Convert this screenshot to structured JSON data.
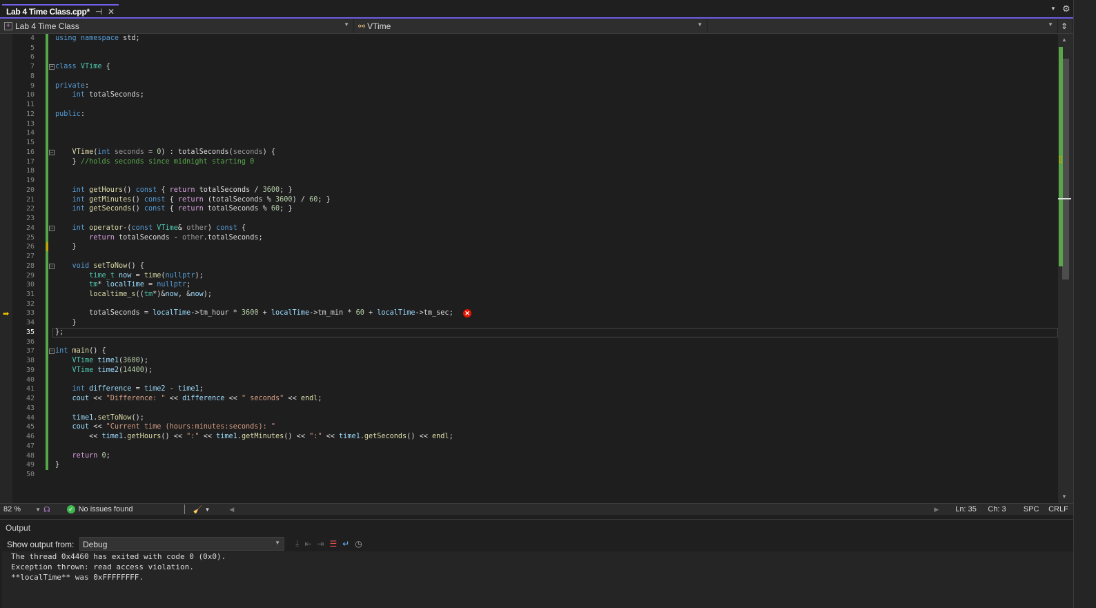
{
  "tab": {
    "title": "Lab 4 Time Class.cpp*",
    "pin_icon": "pin-icon",
    "close_icon": "close-icon"
  },
  "nav": {
    "project": "Lab 4 Time Class",
    "scope": "VTime",
    "member": ""
  },
  "code": {
    "current_line": 35,
    "error_line": 33,
    "lines": [
      {
        "n": 4,
        "t": [
          [
            "kw",
            "using"
          ],
          [
            "pl",
            " "
          ],
          [
            "kw",
            "namespace"
          ],
          [
            "pl",
            " std;"
          ]
        ]
      },
      {
        "n": 5,
        "t": []
      },
      {
        "n": 6,
        "t": []
      },
      {
        "n": 7,
        "t": [
          [
            "kw",
            "class"
          ],
          [
            "pl",
            " "
          ],
          [
            "type",
            "VTime"
          ],
          [
            "pl",
            " {"
          ]
        ],
        "fold": true
      },
      {
        "n": 8,
        "t": []
      },
      {
        "n": 9,
        "t": [
          [
            "kw",
            "private"
          ],
          [
            "pl",
            ":"
          ]
        ]
      },
      {
        "n": 10,
        "t": [
          [
            "pl",
            "    "
          ],
          [
            "kw",
            "int"
          ],
          [
            "pl",
            " "
          ],
          [
            "mem",
            "totalSeconds"
          ],
          [
            "pl",
            ";"
          ]
        ]
      },
      {
        "n": 11,
        "t": []
      },
      {
        "n": 12,
        "t": [
          [
            "kw",
            "public"
          ],
          [
            "pl",
            ":"
          ]
        ]
      },
      {
        "n": 13,
        "t": []
      },
      {
        "n": 14,
        "t": []
      },
      {
        "n": 15,
        "t": []
      },
      {
        "n": 16,
        "t": [
          [
            "pl",
            "    "
          ],
          [
            "fn",
            "VTime"
          ],
          [
            "pl",
            "("
          ],
          [
            "kw",
            "int"
          ],
          [
            "pl",
            " "
          ],
          [
            "par",
            "seconds"
          ],
          [
            "pl",
            " = "
          ],
          [
            "num",
            "0"
          ],
          [
            "pl",
            ") : "
          ],
          [
            "mem",
            "totalSeconds"
          ],
          [
            "pl",
            "("
          ],
          [
            "par",
            "seconds"
          ],
          [
            "pl",
            ") {"
          ]
        ],
        "fold": true
      },
      {
        "n": 17,
        "t": [
          [
            "pl",
            "    } "
          ],
          [
            "cm",
            "//holds seconds since midnight starting 0"
          ]
        ]
      },
      {
        "n": 18,
        "t": []
      },
      {
        "n": 19,
        "t": []
      },
      {
        "n": 20,
        "t": [
          [
            "pl",
            "    "
          ],
          [
            "kw",
            "int"
          ],
          [
            "pl",
            " "
          ],
          [
            "fn",
            "getHours"
          ],
          [
            "pl",
            "() "
          ],
          [
            "kw",
            "const"
          ],
          [
            "pl",
            " { "
          ],
          [
            "ctl",
            "return"
          ],
          [
            "pl",
            " "
          ],
          [
            "mem",
            "totalSeconds"
          ],
          [
            "pl",
            " / "
          ],
          [
            "num",
            "3600"
          ],
          [
            "pl",
            "; }"
          ]
        ]
      },
      {
        "n": 21,
        "t": [
          [
            "pl",
            "    "
          ],
          [
            "kw",
            "int"
          ],
          [
            "pl",
            " "
          ],
          [
            "fn",
            "getMinutes"
          ],
          [
            "pl",
            "() "
          ],
          [
            "kw",
            "const"
          ],
          [
            "pl",
            " { "
          ],
          [
            "ctl",
            "return"
          ],
          [
            "pl",
            " ("
          ],
          [
            "mem",
            "totalSeconds"
          ],
          [
            "pl",
            " % "
          ],
          [
            "num",
            "3600"
          ],
          [
            "pl",
            ") / "
          ],
          [
            "num",
            "60"
          ],
          [
            "pl",
            "; }"
          ]
        ]
      },
      {
        "n": 22,
        "t": [
          [
            "pl",
            "    "
          ],
          [
            "kw",
            "int"
          ],
          [
            "pl",
            " "
          ],
          [
            "fn",
            "getSeconds"
          ],
          [
            "pl",
            "() "
          ],
          [
            "kw",
            "const"
          ],
          [
            "pl",
            " { "
          ],
          [
            "ctl",
            "return"
          ],
          [
            "pl",
            " "
          ],
          [
            "mem",
            "totalSeconds"
          ],
          [
            "pl",
            " % "
          ],
          [
            "num",
            "60"
          ],
          [
            "pl",
            "; }"
          ]
        ]
      },
      {
        "n": 23,
        "t": []
      },
      {
        "n": 24,
        "t": [
          [
            "pl",
            "    "
          ],
          [
            "kw",
            "int"
          ],
          [
            "pl",
            " "
          ],
          [
            "fn",
            "operator-"
          ],
          [
            "pl",
            "("
          ],
          [
            "kw",
            "const"
          ],
          [
            "pl",
            " "
          ],
          [
            "type",
            "VTime"
          ],
          [
            "pl",
            "& "
          ],
          [
            "par",
            "other"
          ],
          [
            "pl",
            ") "
          ],
          [
            "kw",
            "const"
          ],
          [
            "pl",
            " {"
          ]
        ],
        "fold": true
      },
      {
        "n": 25,
        "t": [
          [
            "pl",
            "        "
          ],
          [
            "ctl",
            "return"
          ],
          [
            "pl",
            " "
          ],
          [
            "mem",
            "totalSeconds"
          ],
          [
            "pl",
            " - "
          ],
          [
            "par",
            "other"
          ],
          [
            "pl",
            "."
          ],
          [
            "mem",
            "totalSeconds"
          ],
          [
            "pl",
            ";"
          ]
        ]
      },
      {
        "n": 26,
        "t": [
          [
            "pl",
            "    }"
          ]
        ]
      },
      {
        "n": 27,
        "t": []
      },
      {
        "n": 28,
        "t": [
          [
            "pl",
            "    "
          ],
          [
            "kw",
            "void"
          ],
          [
            "pl",
            " "
          ],
          [
            "fn",
            "setToNow"
          ],
          [
            "pl",
            "() {"
          ]
        ],
        "fold": true
      },
      {
        "n": 29,
        "t": [
          [
            "pl",
            "        "
          ],
          [
            "type",
            "time_t"
          ],
          [
            "pl",
            " "
          ],
          [
            "var",
            "now"
          ],
          [
            "pl",
            " = "
          ],
          [
            "fn",
            "time"
          ],
          [
            "pl",
            "("
          ],
          [
            "kw",
            "nullptr"
          ],
          [
            "pl",
            ");"
          ]
        ]
      },
      {
        "n": 30,
        "t": [
          [
            "pl",
            "        "
          ],
          [
            "type",
            "tm"
          ],
          [
            "pl",
            "* "
          ],
          [
            "var",
            "localTime"
          ],
          [
            "pl",
            " = "
          ],
          [
            "kw",
            "nullptr"
          ],
          [
            "pl",
            ";"
          ]
        ]
      },
      {
        "n": 31,
        "t": [
          [
            "pl",
            "        "
          ],
          [
            "fn",
            "localtime_s"
          ],
          [
            "pl",
            "(("
          ],
          [
            "type",
            "tm"
          ],
          [
            "pl",
            "*)&"
          ],
          [
            "var",
            "now"
          ],
          [
            "pl",
            ", &"
          ],
          [
            "var",
            "now"
          ],
          [
            "pl",
            ");"
          ]
        ]
      },
      {
        "n": 32,
        "t": []
      },
      {
        "n": 33,
        "t": [
          [
            "pl",
            "        "
          ],
          [
            "mem",
            "totalSeconds"
          ],
          [
            "pl",
            " = "
          ],
          [
            "var",
            "localTime"
          ],
          [
            "pl",
            "->"
          ],
          [
            "mem",
            "tm_hour"
          ],
          [
            "pl",
            " * "
          ],
          [
            "num",
            "3600"
          ],
          [
            "pl",
            " + "
          ],
          [
            "var",
            "localTime"
          ],
          [
            "pl",
            "->"
          ],
          [
            "mem",
            "tm_min"
          ],
          [
            "pl",
            " * "
          ],
          [
            "num",
            "60"
          ],
          [
            "pl",
            " + "
          ],
          [
            "var",
            "localTime"
          ],
          [
            "pl",
            "->"
          ],
          [
            "mem",
            "tm_sec"
          ],
          [
            "pl",
            ";"
          ]
        ]
      },
      {
        "n": 34,
        "t": [
          [
            "pl",
            "    }"
          ]
        ]
      },
      {
        "n": 35,
        "t": [
          [
            "pl",
            "};"
          ]
        ]
      },
      {
        "n": 36,
        "t": []
      },
      {
        "n": 37,
        "t": [
          [
            "kw",
            "int"
          ],
          [
            "pl",
            " "
          ],
          [
            "fn",
            "main"
          ],
          [
            "pl",
            "() {"
          ]
        ],
        "fold": true
      },
      {
        "n": 38,
        "t": [
          [
            "pl",
            "    "
          ],
          [
            "type",
            "VTime"
          ],
          [
            "pl",
            " "
          ],
          [
            "var",
            "time1"
          ],
          [
            "pl",
            "("
          ],
          [
            "num",
            "3600"
          ],
          [
            "pl",
            ");"
          ]
        ]
      },
      {
        "n": 39,
        "t": [
          [
            "pl",
            "    "
          ],
          [
            "type",
            "VTime"
          ],
          [
            "pl",
            " "
          ],
          [
            "var",
            "time2"
          ],
          [
            "pl",
            "("
          ],
          [
            "num",
            "14400"
          ],
          [
            "pl",
            ");"
          ]
        ]
      },
      {
        "n": 40,
        "t": []
      },
      {
        "n": 41,
        "t": [
          [
            "pl",
            "    "
          ],
          [
            "kw",
            "int"
          ],
          [
            "pl",
            " "
          ],
          [
            "var",
            "difference"
          ],
          [
            "pl",
            " = "
          ],
          [
            "var",
            "time2"
          ],
          [
            "pl",
            " - "
          ],
          [
            "var",
            "time1"
          ],
          [
            "pl",
            ";"
          ]
        ]
      },
      {
        "n": 42,
        "t": [
          [
            "pl",
            "    "
          ],
          [
            "var",
            "cout"
          ],
          [
            "pl",
            " << "
          ],
          [
            "str",
            "\"Difference: \""
          ],
          [
            "pl",
            " << "
          ],
          [
            "var",
            "difference"
          ],
          [
            "pl",
            " << "
          ],
          [
            "str",
            "\" seconds\""
          ],
          [
            "pl",
            " << "
          ],
          [
            "fn",
            "endl"
          ],
          [
            "pl",
            ";"
          ]
        ]
      },
      {
        "n": 43,
        "t": []
      },
      {
        "n": 44,
        "t": [
          [
            "pl",
            "    "
          ],
          [
            "var",
            "time1"
          ],
          [
            "pl",
            "."
          ],
          [
            "fn",
            "setToNow"
          ],
          [
            "pl",
            "();"
          ]
        ]
      },
      {
        "n": 45,
        "t": [
          [
            "pl",
            "    "
          ],
          [
            "var",
            "cout"
          ],
          [
            "pl",
            " << "
          ],
          [
            "str",
            "\"Current time (hours:minutes:seconds): \""
          ]
        ]
      },
      {
        "n": 46,
        "t": [
          [
            "pl",
            "        << "
          ],
          [
            "var",
            "time1"
          ],
          [
            "pl",
            "."
          ],
          [
            "fn",
            "getHours"
          ],
          [
            "pl",
            "() << "
          ],
          [
            "str",
            "\":\""
          ],
          [
            "pl",
            " << "
          ],
          [
            "var",
            "time1"
          ],
          [
            "pl",
            "."
          ],
          [
            "fn",
            "getMinutes"
          ],
          [
            "pl",
            "() << "
          ],
          [
            "str",
            "\":\""
          ],
          [
            "pl",
            " << "
          ],
          [
            "var",
            "time1"
          ],
          [
            "pl",
            "."
          ],
          [
            "fn",
            "getSeconds"
          ],
          [
            "pl",
            "() << "
          ],
          [
            "fn",
            "endl"
          ],
          [
            "pl",
            ";"
          ]
        ]
      },
      {
        "n": 47,
        "t": []
      },
      {
        "n": 48,
        "t": [
          [
            "pl",
            "    "
          ],
          [
            "ctl",
            "return"
          ],
          [
            "pl",
            " "
          ],
          [
            "num",
            "0"
          ],
          [
            "pl",
            ";"
          ]
        ]
      },
      {
        "n": 49,
        "t": [
          [
            "pl",
            "}"
          ]
        ]
      },
      {
        "n": 50,
        "t": []
      }
    ]
  },
  "status": {
    "zoom": "82 %",
    "issues": "No issues found",
    "line": "Ln: 35",
    "col": "Ch: 3",
    "indent": "SPC",
    "eol": "CRLF"
  },
  "output": {
    "title": "Output",
    "show_from_label": "Show output from:",
    "source": "Debug",
    "lines": [
      "The thread 0x4460 has exited with code 0 (0x0).",
      "Exception thrown: read access violation.",
      "**localTime** was 0xFFFFFFFF."
    ]
  },
  "colors": {
    "accent": "#7160e8",
    "change": "#57a64a",
    "error": "#e51400"
  }
}
